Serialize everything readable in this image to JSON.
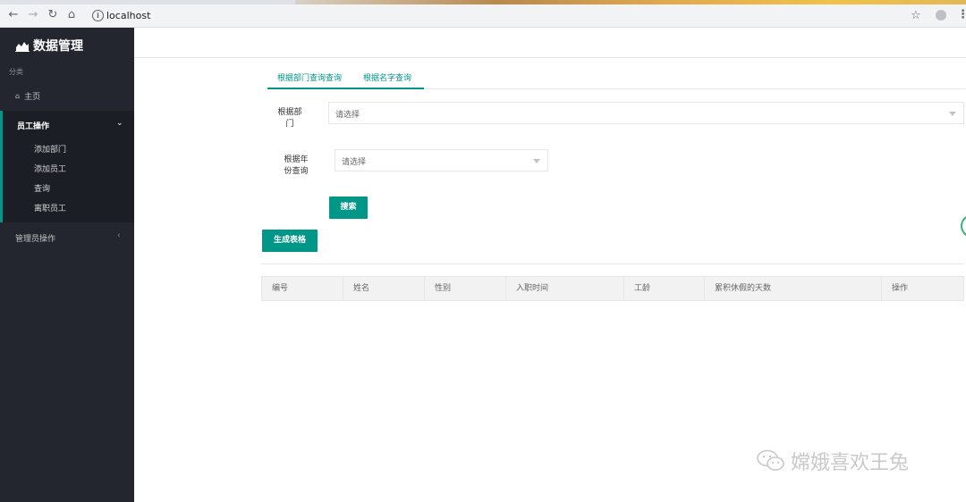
{
  "browser": {
    "url": "localhost",
    "back_icon": "←",
    "forward_icon": "→",
    "reload_icon": "↻",
    "home_icon": "⌂",
    "info_icon": "i",
    "star_icon": "☆",
    "menu_icon": "⋮"
  },
  "sidebar": {
    "brand": "数据管理",
    "category": "分类",
    "home": "主页",
    "group": {
      "title": "员工操作",
      "items": [
        "添加部门",
        "添加员工",
        "查询",
        "离职员工"
      ]
    },
    "admin": "管理员操作",
    "chevron_down": "⌄",
    "chevron_left": "‹"
  },
  "tabs": [
    "根据部门查询查询",
    "根据名字查询"
  ],
  "form": {
    "dept_label": "根据部门",
    "dept_placeholder": "请选择",
    "year_label": "根据年份查询",
    "year_placeholder": "请选择",
    "search_button": "搜索",
    "generate_button": "生成表格"
  },
  "table": {
    "headers": [
      "编号",
      "姓名",
      "性别",
      "入职时间",
      "工龄",
      "累积休假的天数",
      "操作"
    ]
  },
  "watermark": "嫦娥喜欢王兔",
  "colors": {
    "accent": "#009688",
    "sidebar_bg": "#23262e"
  }
}
